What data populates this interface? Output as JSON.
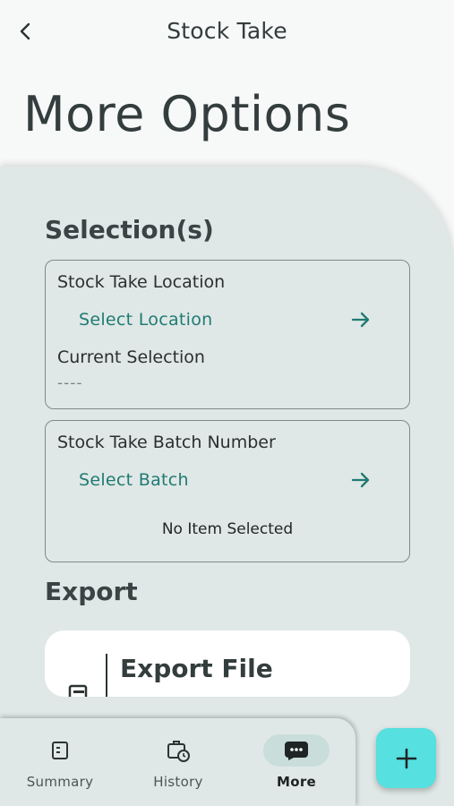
{
  "header": {
    "title": "Stock Take",
    "back_icon": "chevron-left-icon"
  },
  "page": {
    "title": "More Options"
  },
  "selections": {
    "heading": "Selection(s)",
    "location_card": {
      "label": "Stock Take Location",
      "select_text": "Select Location",
      "arrow_icon": "arrow-right-icon",
      "current_label": "Current Selection",
      "current_value": "----"
    },
    "batch_card": {
      "label": "Stock Take Batch Number",
      "select_text": "Select Batch",
      "arrow_icon": "arrow-right-icon",
      "status": "No Item Selected"
    }
  },
  "export": {
    "heading": "Export",
    "file_button_label": "Export File",
    "file_icon": "file-export-icon"
  },
  "bottom_nav": {
    "items": [
      {
        "label": "Summary",
        "icon": "summary-icon",
        "active": false
      },
      {
        "label": "History",
        "icon": "history-icon",
        "active": false
      },
      {
        "label": "More",
        "icon": "more-icon",
        "active": true
      }
    ]
  },
  "fab": {
    "icon": "plus-icon"
  },
  "colors": {
    "accent": "#217a74",
    "panel_bg": "#dfe8e6",
    "fab_bg": "#56e0e0",
    "active_pill": "#c9dedb"
  }
}
